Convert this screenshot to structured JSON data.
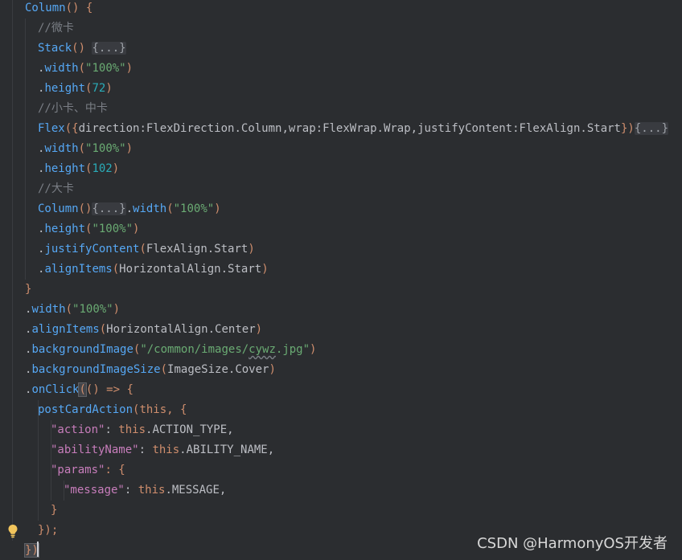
{
  "editor": {
    "theme_colors": {
      "background": "#2b2d30",
      "keyword": "#cf8e6d",
      "function": "#56a8f5",
      "property": "#c77dbb",
      "string": "#6aab73",
      "number": "#2aacb8",
      "comment": "#7a7e85",
      "default": "#bcbec4"
    },
    "lines": [
      [
        {
          "t": "Column",
          "c": "fn"
        },
        {
          "t": "() ",
          "c": "kw"
        },
        {
          "t": "{",
          "c": "kw"
        }
      ],
      [
        {
          "t": "//微卡",
          "c": "cmt"
        }
      ],
      [
        {
          "t": "Stack",
          "c": "fn"
        },
        {
          "t": "() ",
          "c": "kw"
        },
        {
          "t": "{...}",
          "c": "fold"
        }
      ],
      [
        {
          "t": ".",
          "c": "dot"
        },
        {
          "t": "width",
          "c": "fn"
        },
        {
          "t": "(",
          "c": "kw"
        },
        {
          "t": "\"100%\"",
          "c": "str"
        },
        {
          "t": ")",
          "c": "kw"
        }
      ],
      [
        {
          "t": ".",
          "c": "dot"
        },
        {
          "t": "height",
          "c": "fn"
        },
        {
          "t": "(",
          "c": "kw"
        },
        {
          "t": "72",
          "c": "num"
        },
        {
          "t": ")",
          "c": "kw"
        }
      ],
      [
        {
          "t": "//小卡、中卡",
          "c": "cmt"
        }
      ],
      [
        {
          "t": "Flex",
          "c": "fn"
        },
        {
          "t": "({",
          "c": "kw"
        },
        {
          "t": "direction",
          "c": "const"
        },
        {
          "t": ":",
          "c": "const"
        },
        {
          "t": "FlexDirection",
          "c": "const"
        },
        {
          "t": ".",
          "c": "dot"
        },
        {
          "t": "Column",
          "c": "const"
        },
        {
          "t": ",",
          "c": "const"
        },
        {
          "t": "wrap",
          "c": "const"
        },
        {
          "t": ":",
          "c": "const"
        },
        {
          "t": "FlexWrap",
          "c": "const"
        },
        {
          "t": ".",
          "c": "dot"
        },
        {
          "t": "Wrap",
          "c": "const"
        },
        {
          "t": ",",
          "c": "const"
        },
        {
          "t": "justifyContent",
          "c": "const"
        },
        {
          "t": ":",
          "c": "const"
        },
        {
          "t": "FlexAlign",
          "c": "const"
        },
        {
          "t": ".",
          "c": "dot"
        },
        {
          "t": "Start",
          "c": "const"
        },
        {
          "t": "})",
          "c": "kw"
        },
        {
          "t": "{...}",
          "c": "fold"
        }
      ],
      [
        {
          "t": ".",
          "c": "dot"
        },
        {
          "t": "width",
          "c": "fn"
        },
        {
          "t": "(",
          "c": "kw"
        },
        {
          "t": "\"100%\"",
          "c": "str"
        },
        {
          "t": ")",
          "c": "kw"
        }
      ],
      [
        {
          "t": ".",
          "c": "dot"
        },
        {
          "t": "height",
          "c": "fn"
        },
        {
          "t": "(",
          "c": "kw"
        },
        {
          "t": "102",
          "c": "num"
        },
        {
          "t": ")",
          "c": "kw"
        }
      ],
      [
        {
          "t": "//大卡",
          "c": "cmt"
        }
      ],
      [
        {
          "t": "Column",
          "c": "fn"
        },
        {
          "t": "()",
          "c": "kw"
        },
        {
          "t": "{...}",
          "c": "fold"
        },
        {
          "t": ".",
          "c": "dot"
        },
        {
          "t": "width",
          "c": "fn"
        },
        {
          "t": "(",
          "c": "kw"
        },
        {
          "t": "\"100%\"",
          "c": "str"
        },
        {
          "t": ")",
          "c": "kw"
        }
      ],
      [
        {
          "t": ".",
          "c": "dot"
        },
        {
          "t": "height",
          "c": "fn"
        },
        {
          "t": "(",
          "c": "kw"
        },
        {
          "t": "\"100%\"",
          "c": "str"
        },
        {
          "t": ")",
          "c": "kw"
        }
      ],
      [
        {
          "t": ".",
          "c": "dot"
        },
        {
          "t": "justifyContent",
          "c": "fn"
        },
        {
          "t": "(",
          "c": "kw"
        },
        {
          "t": "FlexAlign",
          "c": "const"
        },
        {
          "t": ".",
          "c": "dot"
        },
        {
          "t": "Start",
          "c": "const"
        },
        {
          "t": ")",
          "c": "kw"
        }
      ],
      [
        {
          "t": ".",
          "c": "dot"
        },
        {
          "t": "alignItems",
          "c": "fn"
        },
        {
          "t": "(",
          "c": "kw"
        },
        {
          "t": "HorizontalAlign",
          "c": "const"
        },
        {
          "t": ".",
          "c": "dot"
        },
        {
          "t": "Start",
          "c": "const"
        },
        {
          "t": ")",
          "c": "kw"
        }
      ],
      [
        {
          "t": "}",
          "c": "kw"
        }
      ],
      [
        {
          "t": ".",
          "c": "dot"
        },
        {
          "t": "width",
          "c": "fn"
        },
        {
          "t": "(",
          "c": "kw"
        },
        {
          "t": "\"100%\"",
          "c": "str"
        },
        {
          "t": ")",
          "c": "kw"
        }
      ],
      [
        {
          "t": ".",
          "c": "dot"
        },
        {
          "t": "alignItems",
          "c": "fn"
        },
        {
          "t": "(",
          "c": "kw"
        },
        {
          "t": "HorizontalAlign",
          "c": "const"
        },
        {
          "t": ".",
          "c": "dot"
        },
        {
          "t": "Center",
          "c": "const"
        },
        {
          "t": ")",
          "c": "kw"
        }
      ],
      [
        {
          "t": ".",
          "c": "dot"
        },
        {
          "t": "backgroundImage",
          "c": "fn"
        },
        {
          "t": "(",
          "c": "kw"
        },
        {
          "t": "\"/common/images/",
          "c": "str"
        },
        {
          "t": "cywz",
          "c": "str squiggle"
        },
        {
          "t": ".jpg\"",
          "c": "str"
        },
        {
          "t": ")",
          "c": "kw"
        }
      ],
      [
        {
          "t": ".",
          "c": "dot"
        },
        {
          "t": "backgroundImageSize",
          "c": "fn"
        },
        {
          "t": "(",
          "c": "kw"
        },
        {
          "t": "ImageSize",
          "c": "const"
        },
        {
          "t": ".",
          "c": "dot"
        },
        {
          "t": "Cover",
          "c": "const"
        },
        {
          "t": ")",
          "c": "kw"
        }
      ],
      [
        {
          "t": ".",
          "c": "dot"
        },
        {
          "t": "onClick",
          "c": "fn"
        },
        {
          "t": "(",
          "c": "kw bracket-hl"
        },
        {
          "t": "() => {",
          "c": "kw"
        }
      ],
      [
        {
          "t": "postCardAction",
          "c": "fn"
        },
        {
          "t": "(",
          "c": "kw"
        },
        {
          "t": "this",
          "c": "this"
        },
        {
          "t": ", {",
          "c": "kw"
        }
      ],
      [
        {
          "t": "\"action\"",
          "c": "key"
        },
        {
          "t": ": ",
          "c": "const"
        },
        {
          "t": "this",
          "c": "this"
        },
        {
          "t": ".ACTION_TYPE,",
          "c": "const"
        }
      ],
      [
        {
          "t": "\"abilityName\"",
          "c": "key"
        },
        {
          "t": ": ",
          "c": "const"
        },
        {
          "t": "this",
          "c": "this"
        },
        {
          "t": ".ABILITY_NAME,",
          "c": "const"
        }
      ],
      [
        {
          "t": "\"params\"",
          "c": "key"
        },
        {
          "t": ": {",
          "c": "kw"
        }
      ],
      [
        {
          "t": "\"message\"",
          "c": "key"
        },
        {
          "t": ": ",
          "c": "const"
        },
        {
          "t": "this",
          "c": "this"
        },
        {
          "t": ".MESSAGE,",
          "c": "const"
        }
      ],
      [
        {
          "t": "}",
          "c": "kw"
        }
      ],
      [
        {
          "t": "});",
          "c": "kw"
        }
      ],
      [
        {
          "t": "})",
          "c": "kw bracket-hl"
        }
      ]
    ],
    "indent_levels": [
      0,
      1,
      1,
      1,
      1,
      1,
      1,
      1,
      1,
      1,
      1,
      1,
      1,
      1,
      0,
      0,
      0,
      0,
      0,
      0,
      1,
      2,
      2,
      2,
      3,
      2,
      1,
      0
    ],
    "gutter_icon": "lightbulb-icon"
  },
  "watermark": {
    "text": "CSDN @HarmonyOS开发者"
  }
}
